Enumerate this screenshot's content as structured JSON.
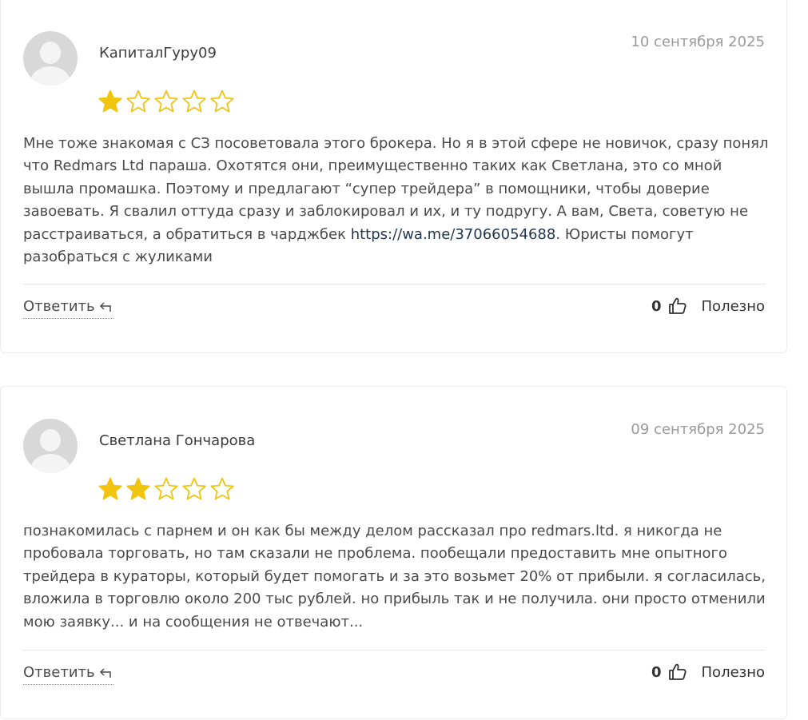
{
  "reviews": [
    {
      "author": "КапиталГуру09",
      "date": "10 сентября 2025",
      "rating": 1,
      "text_before_link": "Мне тоже знакомая с СЗ посоветовала этого брокера. Но я в этой сфере не новичок, сразу понял что Redmars Ltd параша. Охотятся они, преимущественно таких как Светлана, это со мной вышла промашка. Поэтому и предлагают “супер трейдера” в помощники, чтобы доверие завоевать. Я свалил оттуда сразу и заблокировал и их, и ту подругу. А вам, Света, советую не расстраиваться, а обратиться в чарджбек ",
      "link": "https://wa.me/37066054688",
      "text_after_link": ". Юристы помогут разобраться с жуликами",
      "reply_label": "Ответить",
      "helpful_count": "0",
      "helpful_label": "Полезно"
    },
    {
      "author": "Светлана Гончарова",
      "date": "09 сентября 2025",
      "rating": 2,
      "text_before_link": "познакомилась с парнем и он как бы между делом рассказал про redmars.ltd. я никогда не пробовала торговать, но там сказали не проблема. пообещали предоставить мне опытного трейдера в кураторы, который будет помогать и за это возьмет 20% от прибыли. я согласилась, вложила в торговлю около 200 тыс рублей. но прибыль так и не получила. они просто отменили мою заявку... и на сообщения не отвечают...",
      "link": "",
      "text_after_link": "",
      "reply_label": "Ответить",
      "helpful_count": "0",
      "helpful_label": "Полезно"
    }
  ],
  "colors": {
    "star_filled": "#f1c40f",
    "star_outline": "#f1c40f",
    "link": "#1f3550",
    "date": "#9a9a9a"
  },
  "icons": {
    "avatar": "user-placeholder-icon",
    "reply": "reply-arrow-icon",
    "helpful": "thumbs-up-icon"
  }
}
